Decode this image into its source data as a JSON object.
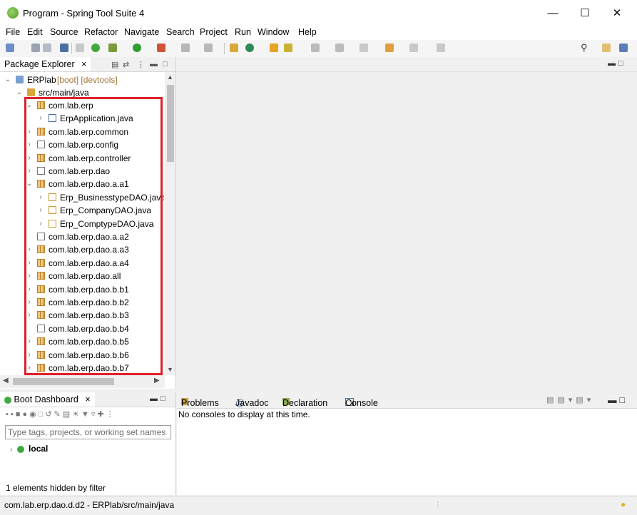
{
  "window": {
    "title": "Program - Spring Tool Suite 4",
    "minimize": "—",
    "maximize": "☐",
    "close": "✕"
  },
  "menu": [
    "File",
    "Edit",
    "Source",
    "Refactor",
    "Navigate",
    "Search",
    "Project",
    "Run",
    "Window",
    "Help"
  ],
  "package_explorer": {
    "tab_label": "Package Explorer",
    "tab_close": "×",
    "project": {
      "name": "ERPlab",
      "suffix": "[boot] [devtools]"
    },
    "source_folder": "src/main/java",
    "rows": [
      {
        "label": "com.lab.erp"
      },
      {
        "label": "ErpApplication.java"
      },
      {
        "label": "com.lab.erp.common"
      },
      {
        "label": "com.lab.erp.config"
      },
      {
        "label": "com.lab.erp.controller"
      },
      {
        "label": "com.lab.erp.dao"
      },
      {
        "label": "com.lab.erp.dao.a.a1"
      },
      {
        "label": "Erp_BusinesstypeDAO.java"
      },
      {
        "label": "Erp_CompanyDAO.java"
      },
      {
        "label": "Erp_ComptypeDAO.java"
      },
      {
        "label": "com.lab.erp.dao.a.a2"
      },
      {
        "label": "com.lab.erp.dao.a.a3"
      },
      {
        "label": "com.lab.erp.dao.a.a4"
      },
      {
        "label": "com.lab.erp.dao.all"
      },
      {
        "label": "com.lab.erp.dao.b.b1"
      },
      {
        "label": "com.lab.erp.dao.b.b2"
      },
      {
        "label": "com.lab.erp.dao.b.b3"
      },
      {
        "label": "com.lab.erp.dao.b.b4"
      },
      {
        "label": "com.lab.erp.dao.b.b5"
      },
      {
        "label": "com.lab.erp.dao.b.b6"
      },
      {
        "label": "com.lab.erp.dao.b.b7"
      }
    ]
  },
  "boot_dashboard": {
    "tab_label": "Boot Dashboard",
    "tab_close": "×",
    "search_placeholder": "Type tags, projects, or working set names",
    "local": "local",
    "hidden_note": "1 elements hidden by filter"
  },
  "console": {
    "tabs": [
      "Problems",
      "Javadoc",
      "Declaration",
      "Console"
    ],
    "tab_close": "×",
    "message": "No consoles to display at this time."
  },
  "status_bar": "com.lab.erp.dao.d.d2 - ERPlab/src/main/java",
  "colors": {
    "highlight_box": "#e0202a"
  }
}
